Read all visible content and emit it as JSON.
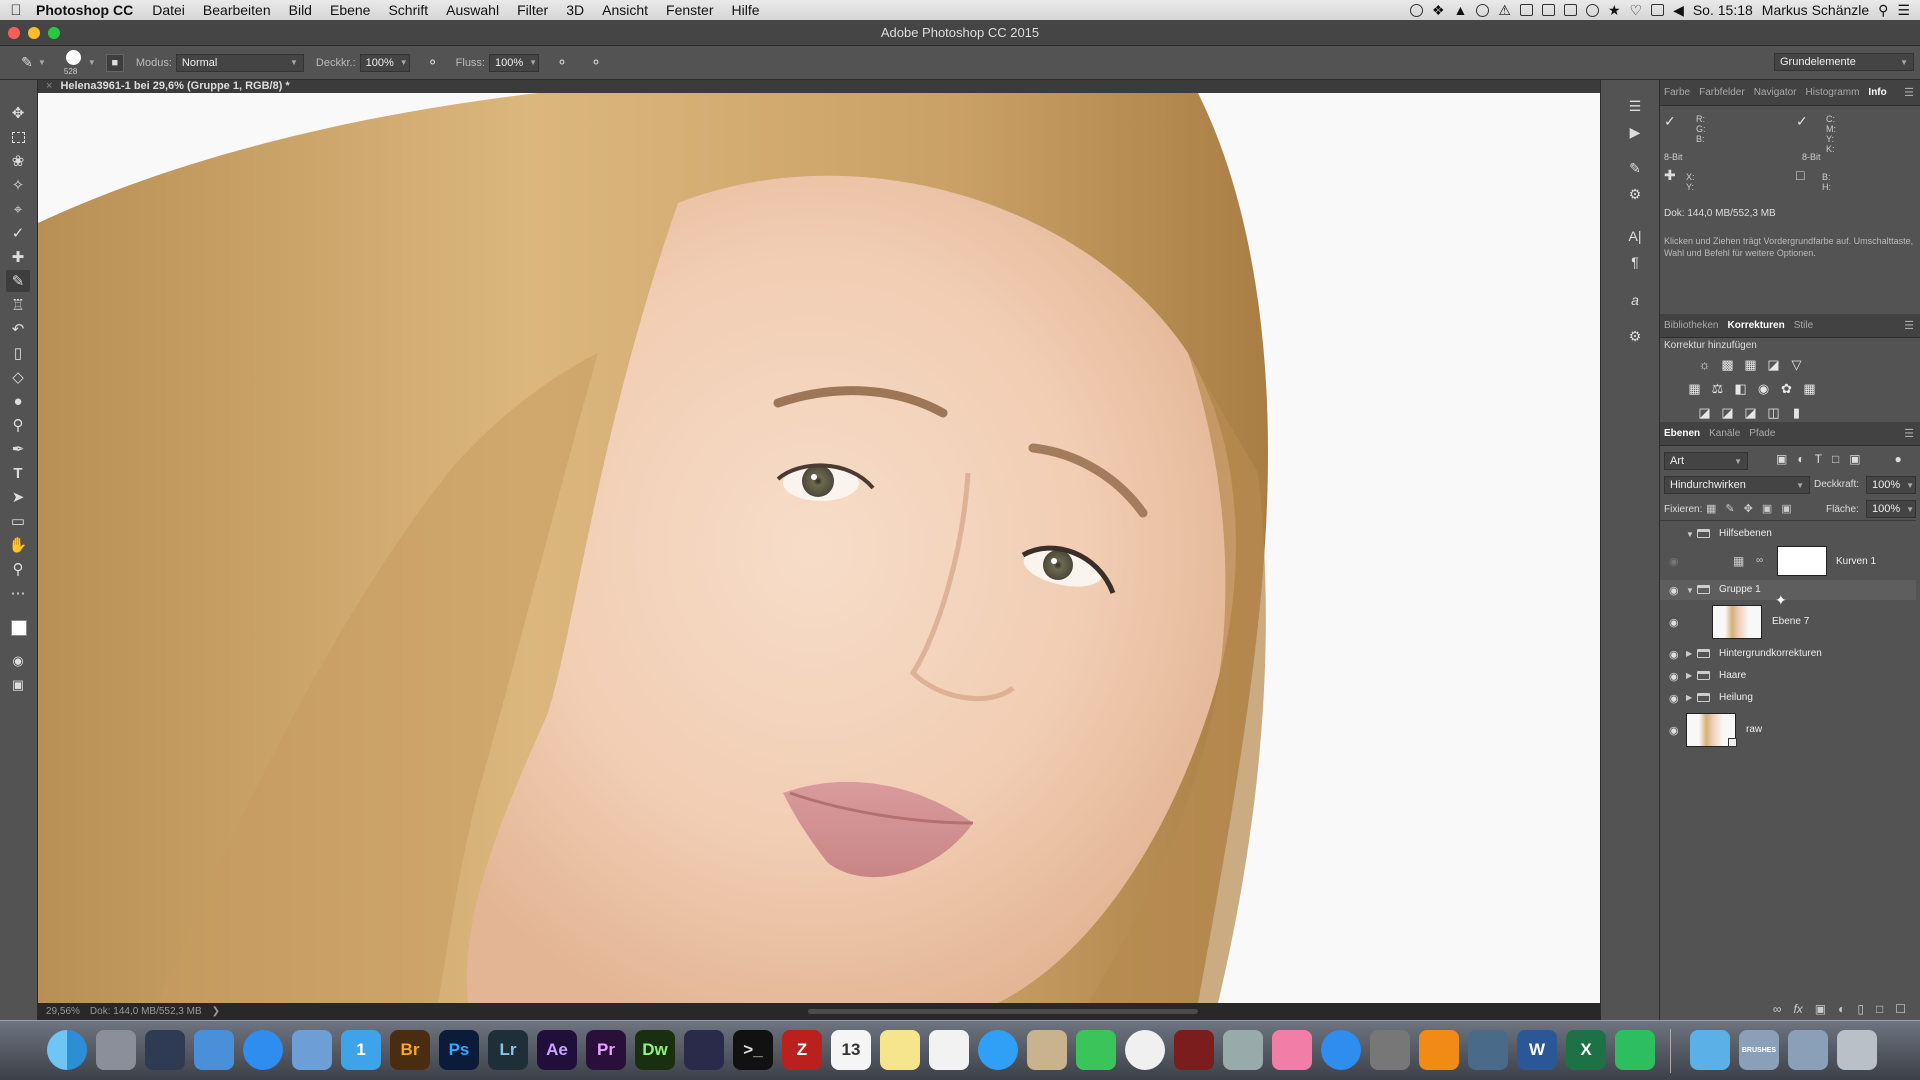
{
  "menubar": {
    "app": "Photoshop CC",
    "items": [
      "Datei",
      "Bearbeiten",
      "Bild",
      "Ebene",
      "Schrift",
      "Auswahl",
      "Filter",
      "3D",
      "Ansicht",
      "Fenster",
      "Hilfe"
    ],
    "clock": "So. 15:18",
    "user": "Markus Schänzle"
  },
  "window": {
    "title": "Adobe Photoshop CC 2015"
  },
  "options": {
    "brush_size": "528",
    "mode_label": "Modus:",
    "mode_value": "Normal",
    "opacity_label": "Deckkr.:",
    "opacity_value": "100%",
    "flow_label": "Fluss:",
    "flow_value": "100%",
    "workspace": "Grundelemente"
  },
  "document": {
    "tab_title": "Helena3961-1 bei 29,6% (Gruppe 1, RGB/8) *",
    "zoom": "29,56%",
    "doc_size": "Dok: 144,0 MB/552,3 MB"
  },
  "tools": [
    "move-tool",
    "marquee-tool",
    "lasso-tool",
    "quick-select-tool",
    "crop-tool",
    "eyedropper-tool",
    "healing-tool",
    "brush-tool",
    "stamp-tool",
    "history-brush-tool",
    "eraser-tool",
    "bucket-tool",
    "blur-tool",
    "dodge-tool",
    "pen-tool",
    "type-tool",
    "path-select-tool",
    "rectangle-tool",
    "hand-tool",
    "zoom-tool",
    "more-tools"
  ],
  "info_panel": {
    "tabs": [
      "Farbe",
      "Farbfelder",
      "Navigator",
      "Histogramm",
      "Info"
    ],
    "active_tab": "Info",
    "rgb_labels": "R:\nG:\nB:",
    "rgb_bits": "8-Bit",
    "cmyk_labels": "C:\nM:\nY:\nK:",
    "cmyk_bits": "8-Bit",
    "xy_labels": "X:\nY:",
    "bh_labels": "B:\nH:",
    "doc": "Dok: 144,0 MB/552,3 MB",
    "help": "Klicken und Ziehen trägt Vordergrundfarbe auf. Umschalttaste, Wahl und Befehl für weitere Optionen."
  },
  "adjustments_panel": {
    "tabs": [
      "Bibliotheken",
      "Korrekturen",
      "Stile"
    ],
    "active_tab": "Korrekturen",
    "subtitle": "Korrektur hinzufügen"
  },
  "layers_panel": {
    "tabs": [
      "Ebenen",
      "Kanäle",
      "Pfade"
    ],
    "active_tab": "Ebenen",
    "filter_kind": "Art",
    "blend_mode": "Hindurchwirken",
    "opacity_label": "Deckkraft:",
    "opacity_value": "100%",
    "lock_label": "Fixieren:",
    "fill_label": "Fläche:",
    "fill_value": "100%",
    "layers": [
      {
        "name": "Hilfsebenen",
        "type": "group",
        "visible": false,
        "expanded": true
      },
      {
        "name": "Kurven 1",
        "type": "adjustment",
        "visible": false
      },
      {
        "name": "Gruppe 1",
        "type": "group",
        "visible": true,
        "expanded": true,
        "selected": true
      },
      {
        "name": "Ebene 7",
        "type": "pixel",
        "visible": true
      },
      {
        "name": "Hintergrundkorrekturen",
        "type": "group",
        "visible": true,
        "expanded": false
      },
      {
        "name": "Haare",
        "type": "group",
        "visible": true,
        "expanded": false
      },
      {
        "name": "Heilung",
        "type": "group",
        "visible": true,
        "expanded": false
      },
      {
        "name": "raw",
        "type": "smart-object",
        "visible": true
      }
    ]
  },
  "dock": [
    {
      "name": "finder",
      "label": ""
    },
    {
      "name": "launchpad",
      "label": ""
    },
    {
      "name": "mission-control",
      "label": ""
    },
    {
      "name": "xcode",
      "label": ""
    },
    {
      "name": "safari",
      "label": ""
    },
    {
      "name": "preview",
      "label": ""
    },
    {
      "name": "1password",
      "label": "1"
    },
    {
      "name": "bridge",
      "label": "Br"
    },
    {
      "name": "photoshop",
      "label": "Ps"
    },
    {
      "name": "lightroom",
      "label": "Lr"
    },
    {
      "name": "after-effects",
      "label": "Ae"
    },
    {
      "name": "premiere",
      "label": "Pr"
    },
    {
      "name": "dreamweaver",
      "label": "Dw"
    },
    {
      "name": "imovie",
      "label": ""
    },
    {
      "name": "terminal",
      "label": ">_"
    },
    {
      "name": "filezilla",
      "label": "Z"
    },
    {
      "name": "calendar",
      "label": "13"
    },
    {
      "name": "notes",
      "label": ""
    },
    {
      "name": "reminders",
      "label": ""
    },
    {
      "name": "messages",
      "label": ""
    },
    {
      "name": "contacts",
      "label": ""
    },
    {
      "name": "facetime",
      "label": ""
    },
    {
      "name": "photos",
      "label": ""
    },
    {
      "name": "photo-booth",
      "label": ""
    },
    {
      "name": "directory-utility",
      "label": ""
    },
    {
      "name": "itunes",
      "label": ""
    },
    {
      "name": "app-store",
      "label": ""
    },
    {
      "name": "system-preferences",
      "label": ""
    },
    {
      "name": "vlc",
      "label": ""
    },
    {
      "name": "quicktime",
      "label": ""
    },
    {
      "name": "word",
      "label": "W"
    },
    {
      "name": "excel",
      "label": "X"
    },
    {
      "name": "evernote",
      "label": ""
    },
    {
      "name": "applications-folder",
      "label": ""
    },
    {
      "name": "brushes-folder",
      "label": "BRUSHES"
    },
    {
      "name": "downloads-folder",
      "label": ""
    },
    {
      "name": "trash",
      "label": ""
    }
  ]
}
